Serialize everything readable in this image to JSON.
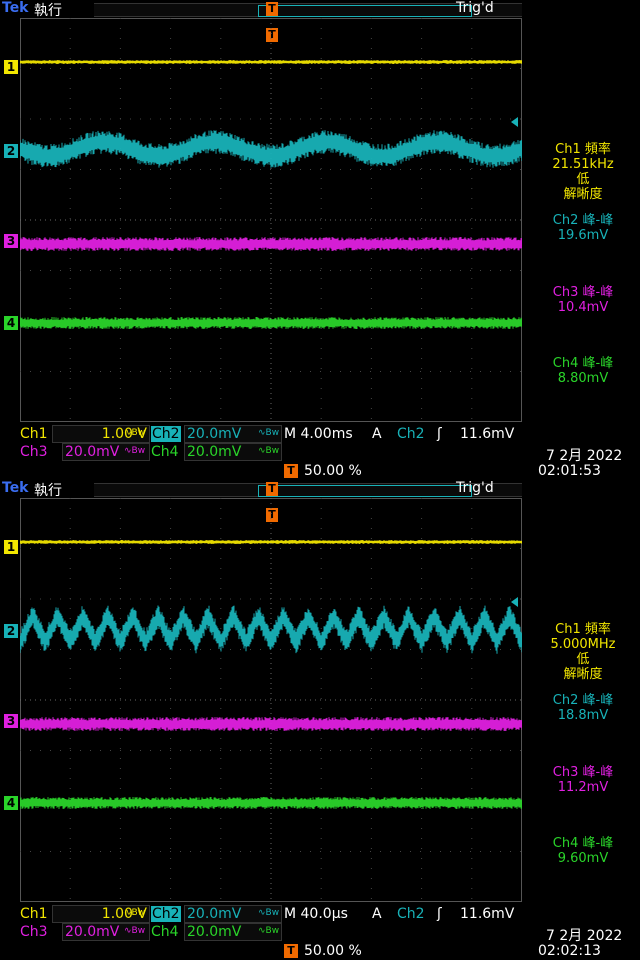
{
  "brand": "Tek",
  "mode": "執行",
  "trig_status": "Trig'd",
  "trigger_marker": "T",
  "channels": [
    {
      "label": "1",
      "color": "#f2e600"
    },
    {
      "label": "2",
      "color": "#18b2b8"
    },
    {
      "label": "3",
      "color": "#e020e0"
    },
    {
      "label": "4",
      "color": "#2ad42a"
    }
  ],
  "screens": [
    {
      "measurements": {
        "ch1_title": "Ch1 頻率",
        "ch1_value": "21.51kHz",
        "ch1_note1": "低",
        "ch1_note2": "解晰度",
        "ch2_title": "Ch2 峰-峰",
        "ch2_value": "19.6mV",
        "ch3_title": "Ch3 峰-峰",
        "ch3_value": "10.4mV",
        "ch4_title": "Ch4 峰-峰",
        "ch4_value": "8.80mV"
      },
      "ch2_cycles": 4.5,
      "settings": {
        "ch1": "Ch1",
        "ch1_scale": "1.00 V",
        "ch2": "Ch2",
        "ch2_scale": "20.0mV",
        "ch3": "Ch3",
        "ch3_scale": "20.0mV",
        "ch4": "Ch4",
        "ch4_scale": "20.0mV",
        "bw": "∿Bw",
        "timebase": "M 4.00ms",
        "trig_mode": "A",
        "trig_source": "Ch2",
        "trig_slope": "ʃ",
        "trig_level": "11.6mV",
        "trig_position": "50.00 %",
        "date": "7 2月  2022",
        "time": "02:01:53"
      }
    },
    {
      "measurements": {
        "ch1_title": "Ch1 頻率",
        "ch1_value": "5.000MHz",
        "ch1_note1": "低",
        "ch1_note2": "解晰度",
        "ch2_title": "Ch2 峰-峰",
        "ch2_value": "18.8mV",
        "ch3_title": "Ch3 峰-峰",
        "ch3_value": "11.2mV",
        "ch4_title": "Ch4 峰-峰",
        "ch4_value": "9.60mV"
      },
      "ch2_cycles": 20,
      "settings": {
        "ch1": "Ch1",
        "ch1_scale": "1.00 V",
        "ch2": "Ch2",
        "ch2_scale": "20.0mV",
        "ch3": "Ch3",
        "ch3_scale": "20.0mV",
        "ch4": "Ch4",
        "ch4_scale": "20.0mV",
        "bw": "∿Bw",
        "timebase": "M 40.0µs",
        "trig_mode": "A",
        "trig_source": "Ch2",
        "trig_slope": "ʃ",
        "trig_level": "11.6mV",
        "trig_position": "50.00 %",
        "date": "7 2月  2022",
        "time": "02:02:13"
      }
    }
  ]
}
